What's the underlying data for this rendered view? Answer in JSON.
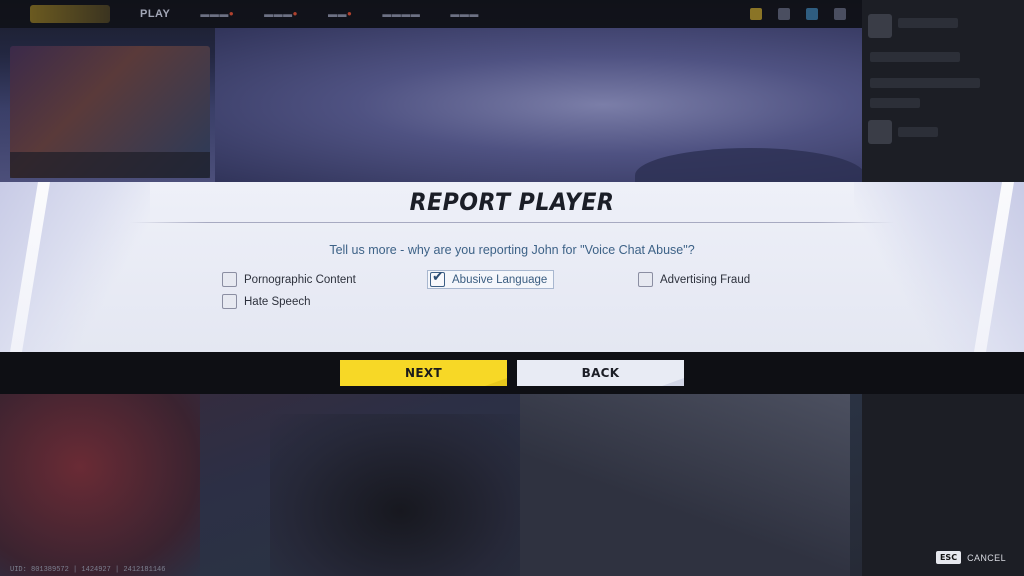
{
  "background": {
    "nav_items": [
      "",
      "",
      "",
      "",
      "",
      ""
    ],
    "promo_label": ""
  },
  "modal": {
    "title": "REPORT PLAYER",
    "question": "Tell us more - why are you reporting John for \"Voice Chat Abuse\"?",
    "options": [
      {
        "label": "Pornographic Content",
        "checked": false
      },
      {
        "label": "Abusive Language",
        "checked": true
      },
      {
        "label": "Advertising Fraud",
        "checked": false
      },
      {
        "label": "Hate Speech",
        "checked": false
      }
    ],
    "check_glyph": "✔"
  },
  "actions": {
    "next_label": "NEXT",
    "back_label": "BACK"
  },
  "footer": {
    "uid_text": "UID: 801389572 | 1424927 | 2412181146",
    "esc_key": "ESC",
    "cancel_label": "CANCEL"
  },
  "colors": {
    "accent_yellow": "#f7d826",
    "question_blue": "#3d6287",
    "modal_bg": "#eef0f8",
    "bar_bg": "#0e0f14"
  }
}
